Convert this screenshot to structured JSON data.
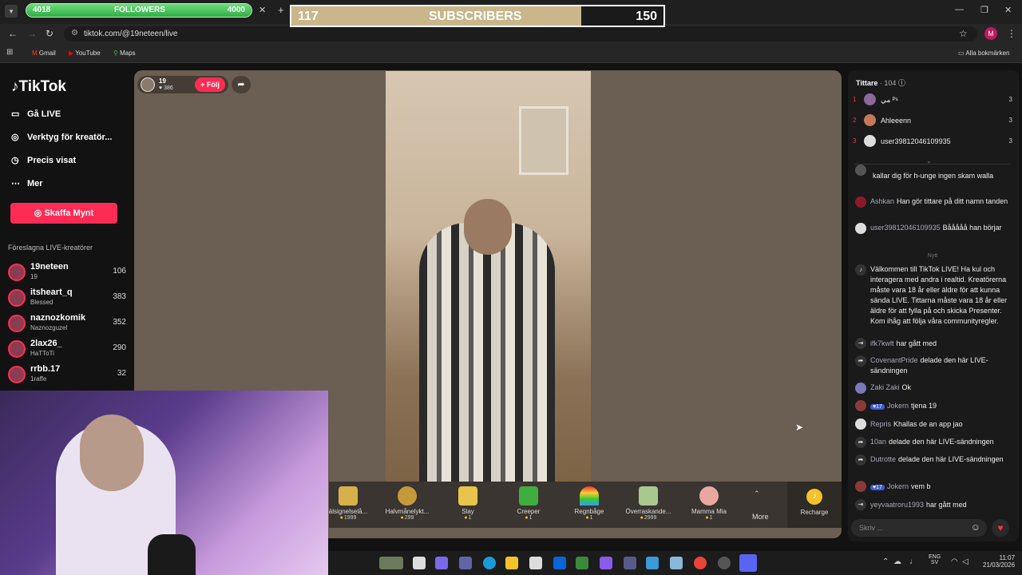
{
  "overlay": {
    "followers_current": "4018",
    "followers_label": "FOLLOWERS",
    "followers_goal": "4000",
    "followers_progress": 1.0,
    "subs_current": "117",
    "subs_label": "SUBSCRIBERS",
    "subs_goal": "150",
    "subs_progress": 0.78
  },
  "browser": {
    "url": "tiktok.com/@19neteen/live",
    "bookmarks": [
      "Gmail",
      "YouTube",
      "Maps"
    ],
    "all_bookmarks": "Alla bokmärken",
    "profile": "M"
  },
  "sidebar": {
    "brand": "TikTok",
    "nav": [
      "Gå LIVE",
      "Verktyg för kreatör...",
      "Precis visat",
      "Mer"
    ],
    "coins_button": "Skaffa Mynt",
    "section_title": "Föreslagna LIVE-kreatörer",
    "creators": [
      {
        "name": "19neteen",
        "sub": "19",
        "viewers": "106"
      },
      {
        "name": "itsheart_q",
        "sub": "Blessed",
        "viewers": "383"
      },
      {
        "name": "naznozkomik",
        "sub": "Naznozguzel",
        "viewers": "352"
      },
      {
        "name": "2lax26_",
        "sub": "HaTToTi",
        "viewers": "290"
      },
      {
        "name": "rrbb.17",
        "sub": "1raffe",
        "viewers": "32"
      }
    ]
  },
  "host": {
    "name": "19",
    "likes": "386",
    "follow": "+ Följ"
  },
  "gifts": [
    {
      "name": "älsignelselå...",
      "price": "1999"
    },
    {
      "name": "Halvmånelykt...",
      "price": "299"
    },
    {
      "name": "Slay",
      "price": "1"
    },
    {
      "name": "Creeper",
      "price": "1"
    },
    {
      "name": "Regnbåge",
      "price": "1"
    },
    {
      "name": "Överraskande...",
      "price": "2999"
    },
    {
      "name": "Mamma Mia",
      "price": "1"
    }
  ],
  "gift_more": "More",
  "recharge": "Recharge",
  "viewers": {
    "title": "Tittare",
    "count": "· 104",
    "top": [
      {
        "rank": "1",
        "name": "مي ᴾˢ",
        "score": "3"
      },
      {
        "rank": "2",
        "name": "Ahleeenn",
        "score": "3"
      },
      {
        "rank": "3",
        "name": "user39812046109935",
        "score": "3"
      }
    ]
  },
  "chat": {
    "items": [
      {
        "user": "",
        "text": "kallar dig för h-unge ingen skam walla"
      },
      {
        "user": "Ashkan",
        "text": "Han gör tittare på ditt namn tanden"
      },
      {
        "user": "user39812046109935",
        "text": "Bååååå han börjar"
      },
      {
        "user": "",
        "text": "Välkommen till TikTok LIVE! Ha kul och interagera med andra i realtid. Kreatörerna måste vara 18 år eller äldre för att kunna sända LIVE. Tittarna måste vara 18 år eller äldre för att fylla på och skicka Presenter. Kom ihåg att följa våra communityregler."
      },
      {
        "user": "ifk7kwlt",
        "text": "har gått med"
      },
      {
        "user": "CovenantPride",
        "text": "delade den här LIVE-sändningen"
      },
      {
        "user": "Zaki Zaki",
        "text": "Ok"
      },
      {
        "user": "Jokern",
        "text": "tjena 19"
      },
      {
        "user": "Repris",
        "text": "Khallas de an app jao"
      },
      {
        "user": "10an",
        "text": "delade den här LIVE-sändningen"
      },
      {
        "user": "Dutrotte",
        "text": "delade den här LIVE-sändningen"
      },
      {
        "user": "Jokern",
        "text": "vem b"
      },
      {
        "user": "yeyvaatroru1993",
        "text": "har gått med"
      }
    ],
    "new_label": "Nytt",
    "placeholder": "Skriv ..."
  },
  "taskbar": {
    "lang": "ENG",
    "region": "SV",
    "time": "11:07",
    "date": "21/03/2026"
  },
  "colors": {
    "accent": "#fe2c55",
    "goal_green": "#2fae46"
  }
}
